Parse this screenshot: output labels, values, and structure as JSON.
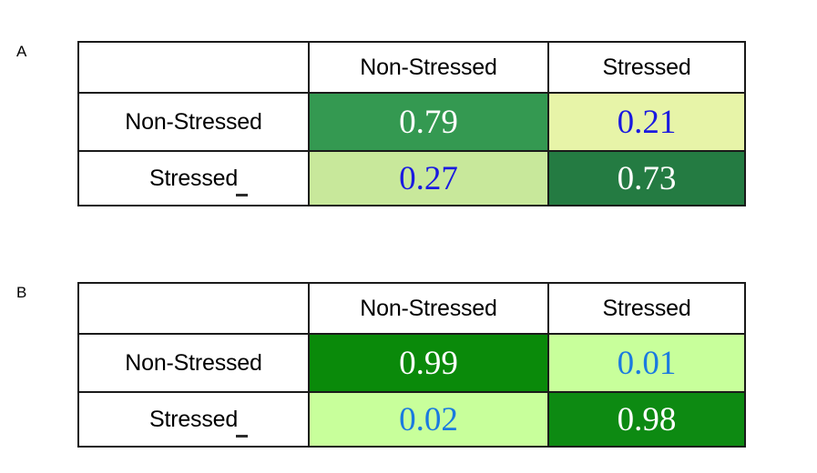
{
  "figure": {
    "background_color": "#ffffff",
    "panels": [
      {
        "letter": "A",
        "corner_label": "",
        "column_headers": [
          "Non-Stressed",
          "Stressed"
        ],
        "row_headers": [
          "Non-Stressed",
          "Stressed"
        ],
        "row_header_artifact": "_",
        "rows": [
          {
            "label": "Non-Stressed",
            "cells": [
              {
                "value": "0.79",
                "fill": "#349951",
                "text_color": "#ffffff"
              },
              {
                "value": "0.21",
                "fill": "#e7f4a8",
                "text_color": "#1a1ae0"
              }
            ]
          },
          {
            "label": "Stressed",
            "cells": [
              {
                "value": "0.27",
                "fill": "#c8e89b",
                "text_color": "#1a1ae0"
              },
              {
                "value": "0.73",
                "fill": "#247b42",
                "text_color": "#ffffff"
              }
            ]
          }
        ]
      },
      {
        "letter": "B",
        "corner_label": "",
        "column_headers": [
          "Non-Stressed",
          "Stressed"
        ],
        "row_headers": [
          "Non-Stressed",
          "Stressed"
        ],
        "row_header_artifact": "_",
        "rows": [
          {
            "label": "Non-Stressed",
            "cells": [
              {
                "value": "0.99",
                "fill": "#0a8a0a",
                "text_color": "#ffffff"
              },
              {
                "value": "0.01",
                "fill": "#c8ff9b",
                "text_color": "#1a7ae0"
              }
            ]
          },
          {
            "label": "Stressed",
            "cells": [
              {
                "value": "0.02",
                "fill": "#c8ff9b",
                "text_color": "#1a7ae0"
              },
              {
                "value": "0.98",
                "fill": "#0d8a12",
                "text_color": "#ffffff"
              }
            ]
          }
        ]
      }
    ]
  },
  "chart_data": {
    "type": "table",
    "title": "",
    "description": "Two confusion matrices comparing Non-Stressed and Stressed classification rates",
    "charts": [
      {
        "panel": "A",
        "type": "heatmap",
        "categories_x": [
          "Non-Stressed",
          "Stressed"
        ],
        "categories_y": [
          "Non-Stressed",
          "Stressed"
        ],
        "values": [
          [
            0.79,
            0.21
          ],
          [
            0.27,
            0.73
          ]
        ],
        "xlabel": "",
        "ylabel": "",
        "grid": true,
        "legend": ""
      },
      {
        "panel": "B",
        "type": "heatmap",
        "categories_x": [
          "Non-Stressed",
          "Stressed"
        ],
        "categories_y": [
          "Non-Stressed",
          "Stressed"
        ],
        "values": [
          [
            0.99,
            0.01
          ],
          [
            0.02,
            0.98
          ]
        ],
        "xlabel": "",
        "ylabel": "",
        "grid": true,
        "legend": ""
      }
    ]
  }
}
